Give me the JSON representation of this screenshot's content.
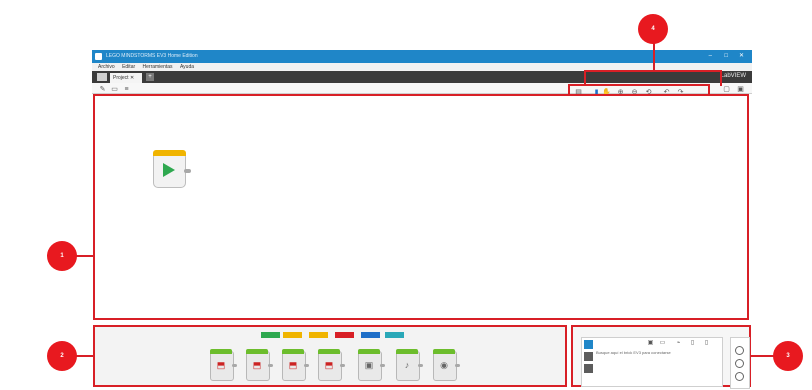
{
  "window": {
    "title": "LEGO MINDSTORMS EV3 Home Edition"
  },
  "menu": [
    "Archivo",
    "Editar",
    "Herramientas",
    "Ayuda"
  ],
  "tab": {
    "label": "Project ✕",
    "add": "+"
  },
  "brand": "LabVIEW",
  "window_controls": [
    "–",
    "□",
    "✕"
  ],
  "callouts": [
    "1",
    "2",
    "3",
    "4"
  ],
  "hw_panel": {
    "text": "Busque aquí el brick EV3 para conectarse"
  },
  "palette_tab_colors": [
    "#2ea84f",
    "#f0b400",
    "#f0b400",
    "#d81f26",
    "#1f6fc8",
    "#2aa8b8"
  ]
}
